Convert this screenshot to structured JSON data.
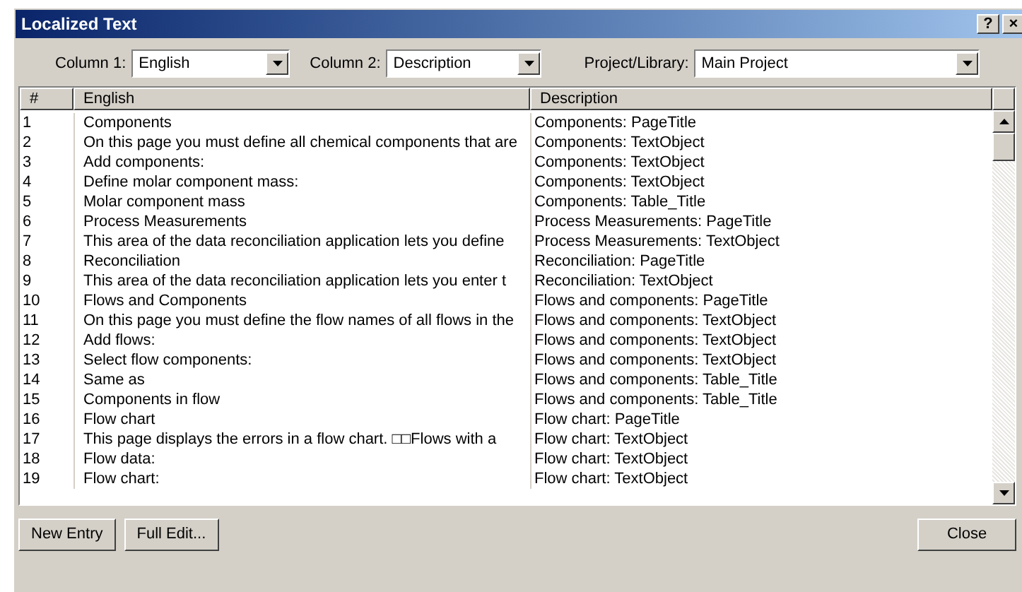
{
  "window": {
    "title": "Localized Text",
    "help_button": "?",
    "close_button": "×"
  },
  "filters": [
    {
      "label": "Column 1:",
      "value": "English"
    },
    {
      "label": "Column 2:",
      "value": "Description"
    },
    {
      "label": "Project/Library:",
      "value": "Main Project"
    }
  ],
  "table": {
    "columns": [
      "#",
      "English",
      "Description"
    ],
    "rows": [
      [
        "1",
        "Components",
        "Components: PageTitle"
      ],
      [
        "2",
        "On this page you must define all chemical components that are",
        "Components: TextObject"
      ],
      [
        "3",
        "Add components:",
        "Components: TextObject"
      ],
      [
        "4",
        "Define molar component mass:",
        "Components: TextObject"
      ],
      [
        "5",
        "Molar component mass",
        "Components: Table_Title"
      ],
      [
        "6",
        "Process Measurements",
        "Process Measurements: PageTitle"
      ],
      [
        "7",
        "This area of the data reconciliation application lets you define",
        "Process Measurements: TextObject"
      ],
      [
        "8",
        "Reconciliation",
        "Reconciliation: PageTitle"
      ],
      [
        "9",
        "This area of the data reconciliation application lets you enter t",
        "Reconciliation: TextObject"
      ],
      [
        "10",
        "Flows and Components",
        "Flows and components: PageTitle"
      ],
      [
        "11",
        "On this page you must define the flow names of all flows in the",
        "Flows and components: TextObject"
      ],
      [
        "12",
        "Add flows:",
        "Flows and components: TextObject"
      ],
      [
        "13",
        "Select flow components:",
        "Flows and components: TextObject"
      ],
      [
        "14",
        "Same as",
        "Flows and components: Table_Title"
      ],
      [
        "15",
        "Components in flow",
        "Flows and components: Table_Title"
      ],
      [
        "16",
        "Flow chart",
        "Flow chart: PageTitle"
      ],
      [
        "17",
        "This page displays the errors in a flow chart. □□Flows with a",
        "Flow chart: TextObject"
      ],
      [
        "18",
        "Flow data:",
        "Flow chart: TextObject"
      ],
      [
        "19",
        "Flow chart:",
        "Flow chart: TextObject"
      ]
    ]
  },
  "buttons": [
    "New Entry",
    "Full Edit...",
    "Close"
  ]
}
